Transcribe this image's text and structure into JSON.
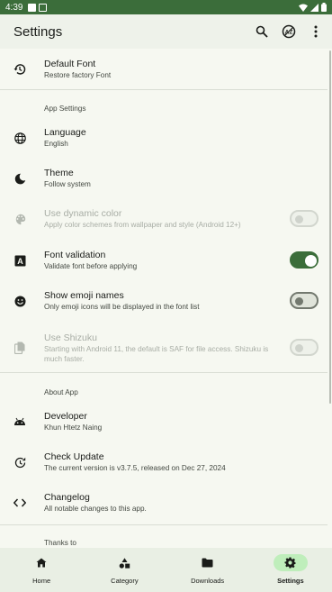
{
  "status_bar": {
    "time": "4:39"
  },
  "app_bar": {
    "title": "Settings"
  },
  "rows": {
    "default_font": {
      "title": "Default Font",
      "subtitle": "Restore factory Font"
    },
    "app_settings_label": "App Settings",
    "language": {
      "title": "Language",
      "subtitle": "English"
    },
    "theme": {
      "title": "Theme",
      "subtitle": "Follow system"
    },
    "dynamic_color": {
      "title": "Use dynamic color",
      "subtitle": "Apply color schemes from wallpaper and style (Android 12+)",
      "enabled": false,
      "checked": false
    },
    "font_validation": {
      "title": "Font validation",
      "subtitle": "Validate font before applying",
      "checked": true
    },
    "emoji_names": {
      "title": "Show emoji names",
      "subtitle": "Only emoji icons will be displayed in the font list",
      "checked": false
    },
    "shizuku": {
      "title": "Use Shizuku",
      "subtitle": "Starting with Android 11, the default is SAF for file access. Shizuku is much faster.",
      "enabled": false,
      "checked": false
    },
    "about_label": "About App",
    "developer": {
      "title": "Developer",
      "subtitle": "Khun Htetz Naing"
    },
    "check_update": {
      "title": "Check Update",
      "subtitle": "The current version is v3.7.5, released on Dec 27, 2024"
    },
    "changelog": {
      "title": "Changelog",
      "subtitle": "All notable changes to this app."
    },
    "thanks_label": "Thanks to"
  },
  "bottom_nav": [
    {
      "label": "Home",
      "icon": "home-icon",
      "active": false
    },
    {
      "label": "Category",
      "icon": "category-icon",
      "active": false
    },
    {
      "label": "Downloads",
      "icon": "folder-icon",
      "active": false
    },
    {
      "label": "Settings",
      "icon": "gear-icon",
      "active": true
    }
  ],
  "colors": {
    "accent": "#3b6d3a",
    "background": "#f6f8f1",
    "nav_active": "#bfeebb"
  }
}
